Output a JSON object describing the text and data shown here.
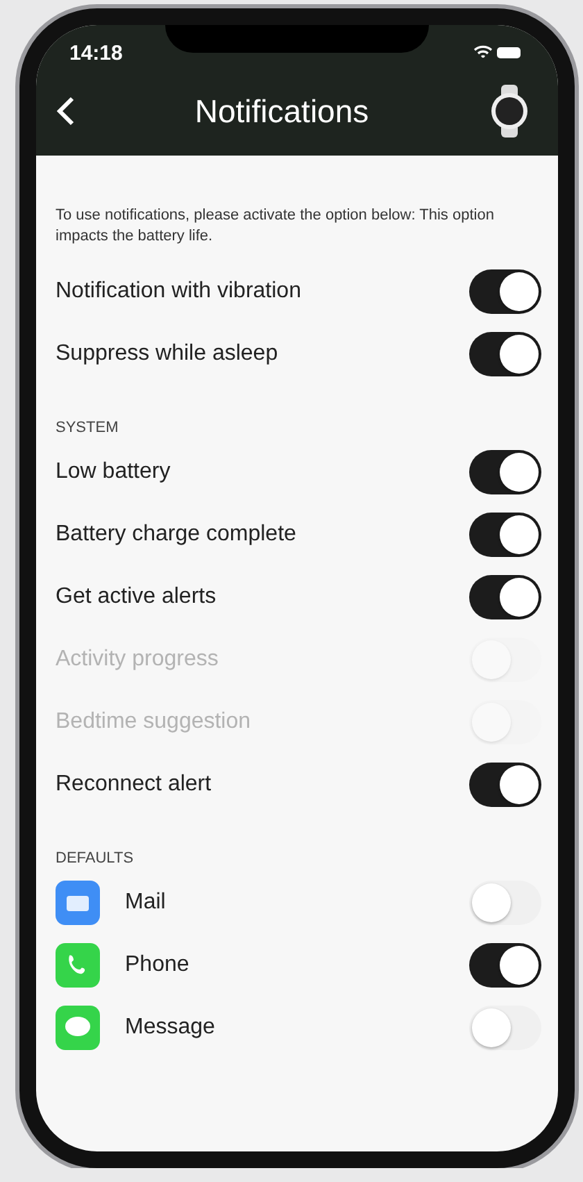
{
  "status_bar": {
    "time": "14:18"
  },
  "nav": {
    "title": "Notifications"
  },
  "intro": "To use notifications, please activate the option below: This option impacts the battery life.",
  "general": [
    {
      "label": "Notification with vibration",
      "on": true,
      "disabled": false
    },
    {
      "label": "Suppress while asleep",
      "on": true,
      "disabled": false
    }
  ],
  "sections": [
    {
      "title": "SYSTEM",
      "items": [
        {
          "kind": "toggle",
          "label": "Low battery",
          "on": true,
          "disabled": false
        },
        {
          "kind": "toggle",
          "label": "Battery charge complete",
          "on": true,
          "disabled": false
        },
        {
          "kind": "toggle",
          "label": "Get active alerts",
          "on": true,
          "disabled": false
        },
        {
          "kind": "toggle",
          "label": "Activity progress",
          "on": false,
          "disabled": true
        },
        {
          "kind": "toggle",
          "label": "Bedtime suggestion",
          "on": false,
          "disabled": true
        },
        {
          "kind": "toggle",
          "label": "Reconnect alert",
          "on": true,
          "disabled": false
        }
      ]
    },
    {
      "title": "DEFAULTS",
      "items": [
        {
          "kind": "mail",
          "label": "Mail",
          "color": "#3f8ef5",
          "on": false,
          "disabled": false
        },
        {
          "kind": "phone",
          "label": "Phone",
          "color": "#35d44a",
          "on": true,
          "disabled": false
        },
        {
          "kind": "message",
          "label": "Message",
          "color": "#35d44a",
          "on": false,
          "disabled": false
        }
      ]
    }
  ]
}
